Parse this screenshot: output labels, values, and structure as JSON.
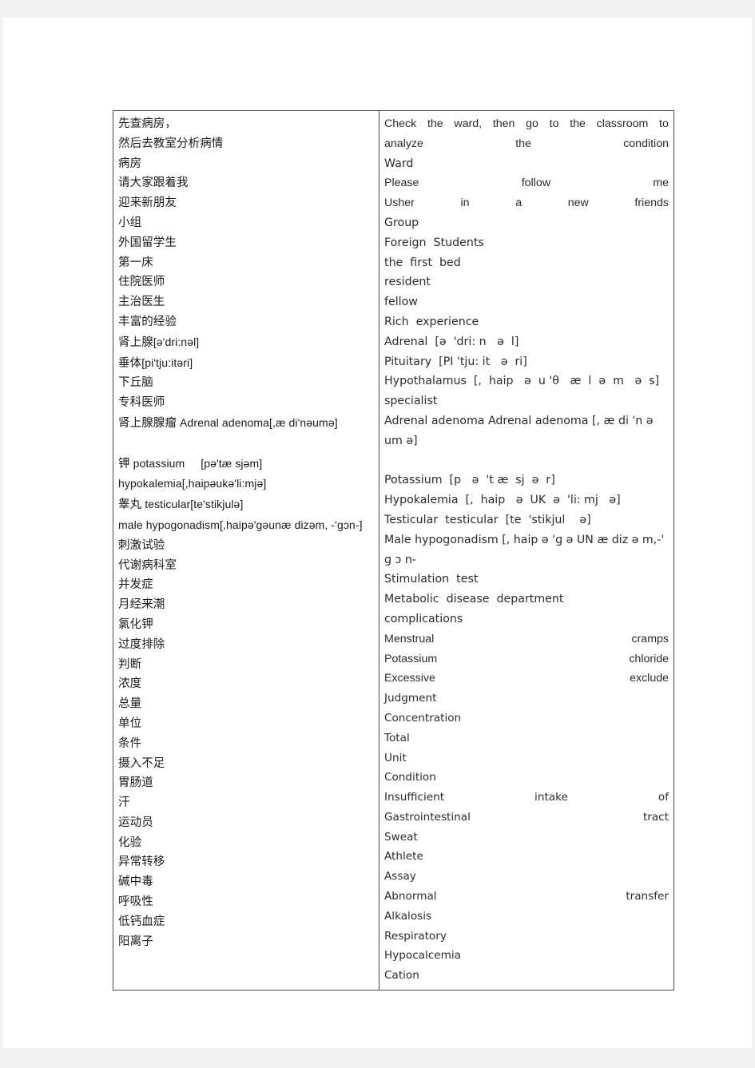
{
  "document": {
    "type": "bilingual-glossary-table",
    "columns": [
      "chinese",
      "english"
    ]
  },
  "rows": [
    {
      "zh": "先查病房，",
      "en_parts": [
        "Check",
        "the",
        "ward,",
        "then",
        "go",
        "to",
        "the",
        "classroom",
        "to"
      ],
      "en_style": "justify"
    },
    {
      "zh": "然后去教室分析病情",
      "en_parts": [
        "analyze",
        "the",
        "condition"
      ],
      "en_style": "justify"
    },
    {
      "zh": "病房",
      "en": "Ward",
      "en_style": "plain"
    },
    {
      "zh": "请大家跟着我",
      "en_parts": [
        "Please",
        "follow",
        "me"
      ],
      "en_style": "justify"
    },
    {
      "zh": "迎来新朋友",
      "en_parts": [
        "Usher",
        "in",
        "a",
        "new",
        "friends"
      ],
      "en_style": "justify"
    },
    {
      "zh": "小组",
      "en": "Group",
      "en_style": "plain"
    },
    {
      "zh": "外国留学生",
      "en": "Foreign  Students",
      "en_style": "plain"
    },
    {
      "zh": "第一床",
      "en": "the  first  bed",
      "en_style": "plain"
    },
    {
      "zh": "住院医师",
      "en": "resident",
      "en_style": "plain"
    },
    {
      "zh": "主治医生",
      "en": "fellow",
      "en_style": "plain"
    },
    {
      "zh": "丰富的经验",
      "en": "Rich  experience",
      "en_style": "plain"
    },
    {
      "zh": "肾上腺[ə'dri:nəl]",
      "zh_head": "肾上腺",
      "zh_tail": "[ə'dri:nəl]",
      "en": "Adrenal  [ə  'dri: n   ə  l]",
      "en_style": "plain"
    },
    {
      "zh": "垂体[pi'tju:itəri]",
      "zh_head": "垂体",
      "zh_tail": "[pi'tju:itəri]",
      "en": "Pituitary  [PI 'tju: it   ə  ri]",
      "en_style": "plain"
    },
    {
      "zh": "下丘脑",
      "en": "Hypothalamus  [,  haip   ə  u 'θ   æ  l  ə  m   ə  s]",
      "en_style": "plain"
    },
    {
      "zh": "专科医师",
      "en": "specialist",
      "en_style": "plain"
    },
    {
      "zh": "肾上腺腺瘤 Adrenal  adenoma[,æ di'nəumə]",
      "zh_head": "肾上腺腺瘤",
      "zh_tail": " Adrenal  adenoma[,æ di'nəumə]",
      "en": "Adrenal  adenoma  Adrenal  adenoma  [, æ  di 'n  ə um   ə]",
      "en_style": "wrap"
    },
    {
      "zh": "",
      "en": "",
      "en_style": "blank",
      "blank": true
    },
    {
      "zh": "钾 potassium     [pə'tæ sjəm]",
      "zh_head": "钾",
      "zh_tail": " potassium     [pə'tæ sjəm]",
      "en": "Potassium  [p   ə  't æ  sj  ə  r]",
      "en_style": "plain"
    },
    {
      "zh": "hypokalemia[,haipəukə'li:mjə]",
      "zh_all_latin": true,
      "en": "Hypokalemia  [,  haip   ə  UK  ə  'li: mj   ə]",
      "en_style": "plain"
    },
    {
      "zh": "睾丸 testicular[te'stikjulə]",
      "zh_head": "睾丸",
      "zh_tail": " testicular[te'stikjulə]",
      "en": "Testicular  testicular  [te  'stikjul    ə]",
      "en_style": "plain"
    },
    {
      "zh": "male  hypogonadism[,haipə'ɡəunæ dizəm,  -'ɡɔn-]",
      "zh_all_latin": true,
      "en": "Male  hypogonadism  [,  haip   ə  'ɡ  ə  UN  æ  diz  ə  m,-'  ɡ  ɔ  n-",
      "en_style": "wrap"
    },
    {
      "zh": "刺激试验",
      "en": "Stimulation  test",
      "en_style": "plain"
    },
    {
      "zh": "代谢病科室",
      "en": "Metabolic  disease  department",
      "en_style": "plain"
    },
    {
      "zh": "并发症",
      "en": "complications",
      "en_style": "plain"
    },
    {
      "zh": "月经来潮",
      "en_parts": [
        "Menstrual",
        "cramps"
      ],
      "en_style": "justify"
    },
    {
      "zh": "氯化钾",
      "en_parts": [
        "Potassium",
        "chloride"
      ],
      "en_style": "justify"
    },
    {
      "zh": "过度排除",
      "en_parts": [
        "Excessive",
        "exclude"
      ],
      "en_style": "justify"
    },
    {
      "zh": "判断",
      "en": "Judgment",
      "en_style": "alt"
    },
    {
      "zh": "浓度",
      "en": "Concentration",
      "en_style": "alt"
    },
    {
      "zh": "总量",
      "en": "Total",
      "en_style": "alt"
    },
    {
      "zh": "单位",
      "en": "Unit",
      "en_style": "alt"
    },
    {
      "zh": "条件",
      "en": "Condition",
      "en_style": "alt"
    },
    {
      "zh": "摄入不足",
      "en_parts": [
        "Insufficient",
        "intake",
        "of"
      ],
      "en_style": "justify-alt"
    },
    {
      "zh": "胃肠道",
      "en_parts": [
        "Gastrointestinal",
        "tract"
      ],
      "en_style": "justify-alt"
    },
    {
      "zh": "汗",
      "en": "Sweat",
      "en_style": "alt"
    },
    {
      "zh": "运动员",
      "en": "Athlete",
      "en_style": "alt"
    },
    {
      "zh": "化验",
      "en": "Assay",
      "en_style": "alt"
    },
    {
      "zh": "异常转移",
      "en_parts": [
        "Abnormal",
        "transfer"
      ],
      "en_style": "justify-alt"
    },
    {
      "zh": "碱中毒",
      "en": "Alkalosis",
      "en_style": "alt"
    },
    {
      "zh": "呼吸性",
      "en": "Respiratory",
      "en_style": "alt"
    },
    {
      "zh": "低钙血症",
      "en": "Hypocalcemia",
      "en_style": "alt"
    },
    {
      "zh": "阳离子",
      "en": "Cation",
      "en_style": "alt"
    }
  ]
}
